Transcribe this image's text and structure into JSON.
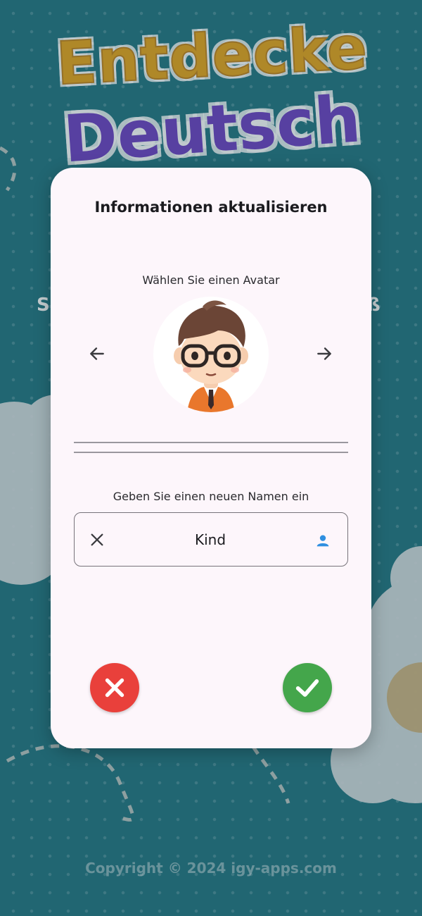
{
  "background": {
    "logo_line1": "Entdecke",
    "logo_line2": "Deutsch",
    "logo_peek_left": "S",
    "logo_peek_right": "ß",
    "copyright": "Copyright © 2024 igy-apps.com",
    "color": "#1f7480"
  },
  "dialog": {
    "title": "Informationen aktualisieren",
    "avatar_label": "Wählen Sie einen Avatar",
    "prev_icon": "arrow-left-icon",
    "next_icon": "arrow-right-icon",
    "avatar_image": "boy-with-glasses-avatar",
    "name_label": "Geben Sie einen neuen Namen ein",
    "name_value": "Kind",
    "clear_icon": "close-icon",
    "field_icon": "person-icon",
    "cancel_icon": "close-icon",
    "confirm_icon": "checkmark-icon",
    "colors": {
      "surface": "#fdf6fb",
      "cancel": "#e9403b",
      "confirm": "#44a64b",
      "person_icon": "#2f8fe0"
    }
  }
}
